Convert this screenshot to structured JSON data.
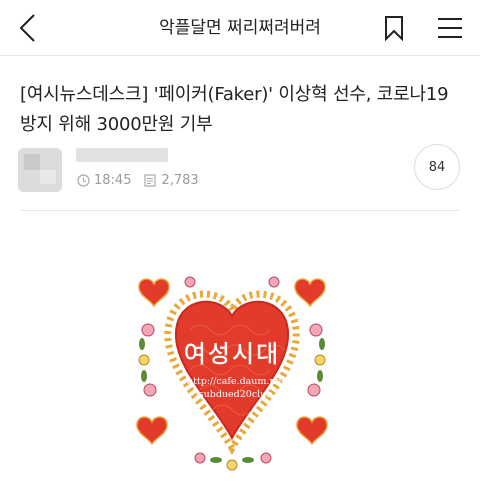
{
  "header": {
    "title": "악플달면 쩌리쩌려버려",
    "back_icon": "back-chevron-icon",
    "bookmark_icon": "bookmark-icon",
    "menu_icon": "hamburger-menu-icon"
  },
  "post": {
    "title": "[여시뉴스데스크] '페이커(Faker)' 이상혁 선수, 코로나19 방지 위해 3000만원 기부",
    "time": "18:45",
    "views": "2,783",
    "comment_count": "84"
  },
  "logo": {
    "name": "여성시대",
    "url": "http://cafe.daum.net",
    "path": "/subdued20club"
  },
  "colors": {
    "heart_red": "#e23a2b",
    "text_primary": "#222222",
    "text_muted": "#9a9a9a"
  }
}
